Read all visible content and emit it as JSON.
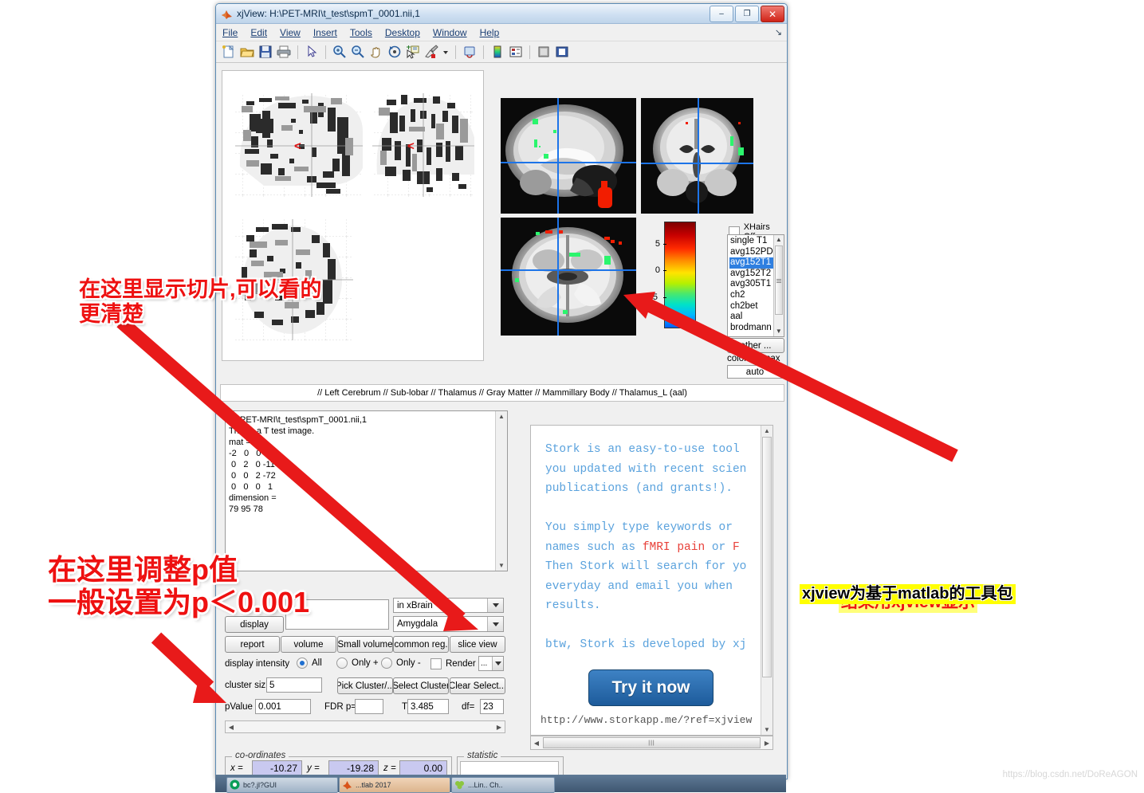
{
  "window": {
    "title": "xjView: H:\\PET-MRI\\t_test\\spmT_0001.nii,1",
    "icon": "matlab-icon",
    "minimize": "–",
    "maximize": "❐",
    "close": "✕"
  },
  "menubar": {
    "items": [
      "File",
      "Edit",
      "View",
      "Insert",
      "Tools",
      "Desktop",
      "Window",
      "Help"
    ],
    "corner": "↘"
  },
  "toolbar": {
    "icons": [
      "new-figure-icon",
      "open-file-icon",
      "save-figure-icon",
      "print-figure-icon",
      "pointer-icon",
      "zoom-in-icon",
      "zoom-out-icon",
      "pan-icon",
      "rotate-3d-icon",
      "data-cursor-icon",
      "brush-icon",
      "brush-dropdown-icon",
      "link-plot-icon",
      "colorbar-icon",
      "legend-icon",
      "hide-plot-tools-icon",
      "show-plot-tools-icon"
    ]
  },
  "viewer": {
    "mip_panel_name": "glass-brain-mip-panel",
    "slices": [
      {
        "name": "sagittal-slice",
        "label": "sagittal"
      },
      {
        "name": "coronal-slice",
        "label": "coronal"
      },
      {
        "name": "axial-slice",
        "label": "axial"
      }
    ],
    "colorbar": {
      "name": "intensity-colorbar",
      "ticks": [
        "5",
        "0",
        "-5"
      ],
      "max_label": "colorbar max",
      "max_value": "auto"
    },
    "xhairs_checkbox": "XHairs Off",
    "template_list": {
      "items": [
        "single T1",
        "avg152PD",
        "avg152T1",
        "avg152T2",
        "avg305T1",
        "ch2",
        "ch2bet",
        "aal",
        "brodmann"
      ],
      "selected": "avg152T1"
    },
    "other_button": "other ..."
  },
  "status": {
    "text": "// Left Cerebrum // Sub-lobar // Thalamus // Gray Matter // Mammillary Body // Thalamus_L (aal)"
  },
  "info": {
    "lines": "H:\\PET-MRI\\t_test\\spmT_0001.nii,1\nThis is a T test image.\nmat =\n-2   0   0   80\n 0   2   0 -114\n 0   0   2 -72\n 0   0   0   1\ndimension =\n79 95 78"
  },
  "controls": {
    "display_button": "display",
    "display_field": "",
    "in_brain_combo": "in xBrain",
    "region_combo": "Amygdala",
    "buttons": [
      "report",
      "volume",
      "Small volume",
      "common reg.",
      "slice view"
    ],
    "intensity_label": "display intensity",
    "radios": [
      {
        "label": "All",
        "selected": true
      },
      {
        "label": "Only +",
        "selected": false
      },
      {
        "label": "Only -",
        "selected": false
      }
    ],
    "render_label": "Render .",
    "render_combo": "...",
    "cluster_label": "cluster siz",
    "cluster_value": "5",
    "cluster_buttons": [
      "Pick Cluster/...",
      "Select Cluster",
      "Clear Select..."
    ],
    "pvalue_label": "pValue",
    "pvalue_value": "0.001",
    "fdr_label": "FDR p=",
    "fdr_value": "",
    "t_label": "T",
    "t_value": "3.485",
    "df_label": "df=",
    "df_value": "23"
  },
  "ad": {
    "paragraph1": "Stork is an easy-to-use tool\nyou updated with recent scien\npublications (and grants!).",
    "line_you_simply": "You simply type keywords or ",
    "line_names_a": "names such as ",
    "line_names_hl1": "fMRI pain",
    "line_names_b": " or ",
    "line_names_hl2": "F",
    "line_then": "Then Stork will search for yo",
    "line_everyday": "everyday and email you when ",
    "line_results": "results.",
    "line_btw": "btw, Stork is developed by xj",
    "button": "Try it now",
    "url": "http://www.storkapp.me/?ref=xjview"
  },
  "bottom": {
    "coordinates_legend": "co-ordinates",
    "statistic_legend": "statistic",
    "x_label": "x =",
    "x_value": "-10.27",
    "y_label": "y =",
    "y_value": "-19.28",
    "z_label": "z =",
    "z_value": "0.00",
    "statistic_value": ""
  },
  "taskbar": {
    "items": [
      "bc?.jl?GUI",
      "...tlab 2017",
      "...Lin.. Ch.."
    ]
  },
  "annotations": {
    "slice_note": "在这里显示切片,可以看的\n更清楚",
    "pvalue_note": "在这里调整p值\n一般设置为p＜0.001",
    "result_note": "结果用xjview显示",
    "toolbox_note": "xjview为基于matlab的工具包",
    "arrow_color": "#e81a1a"
  },
  "watermark": "https://blog.csdn.net/DoReAGON",
  "colors": {
    "accent_blue": "#2f7fe0",
    "crosshair": "#1d74e8",
    "annotation_red": "#ee1111",
    "highlight_yellow": "#ffff00"
  }
}
